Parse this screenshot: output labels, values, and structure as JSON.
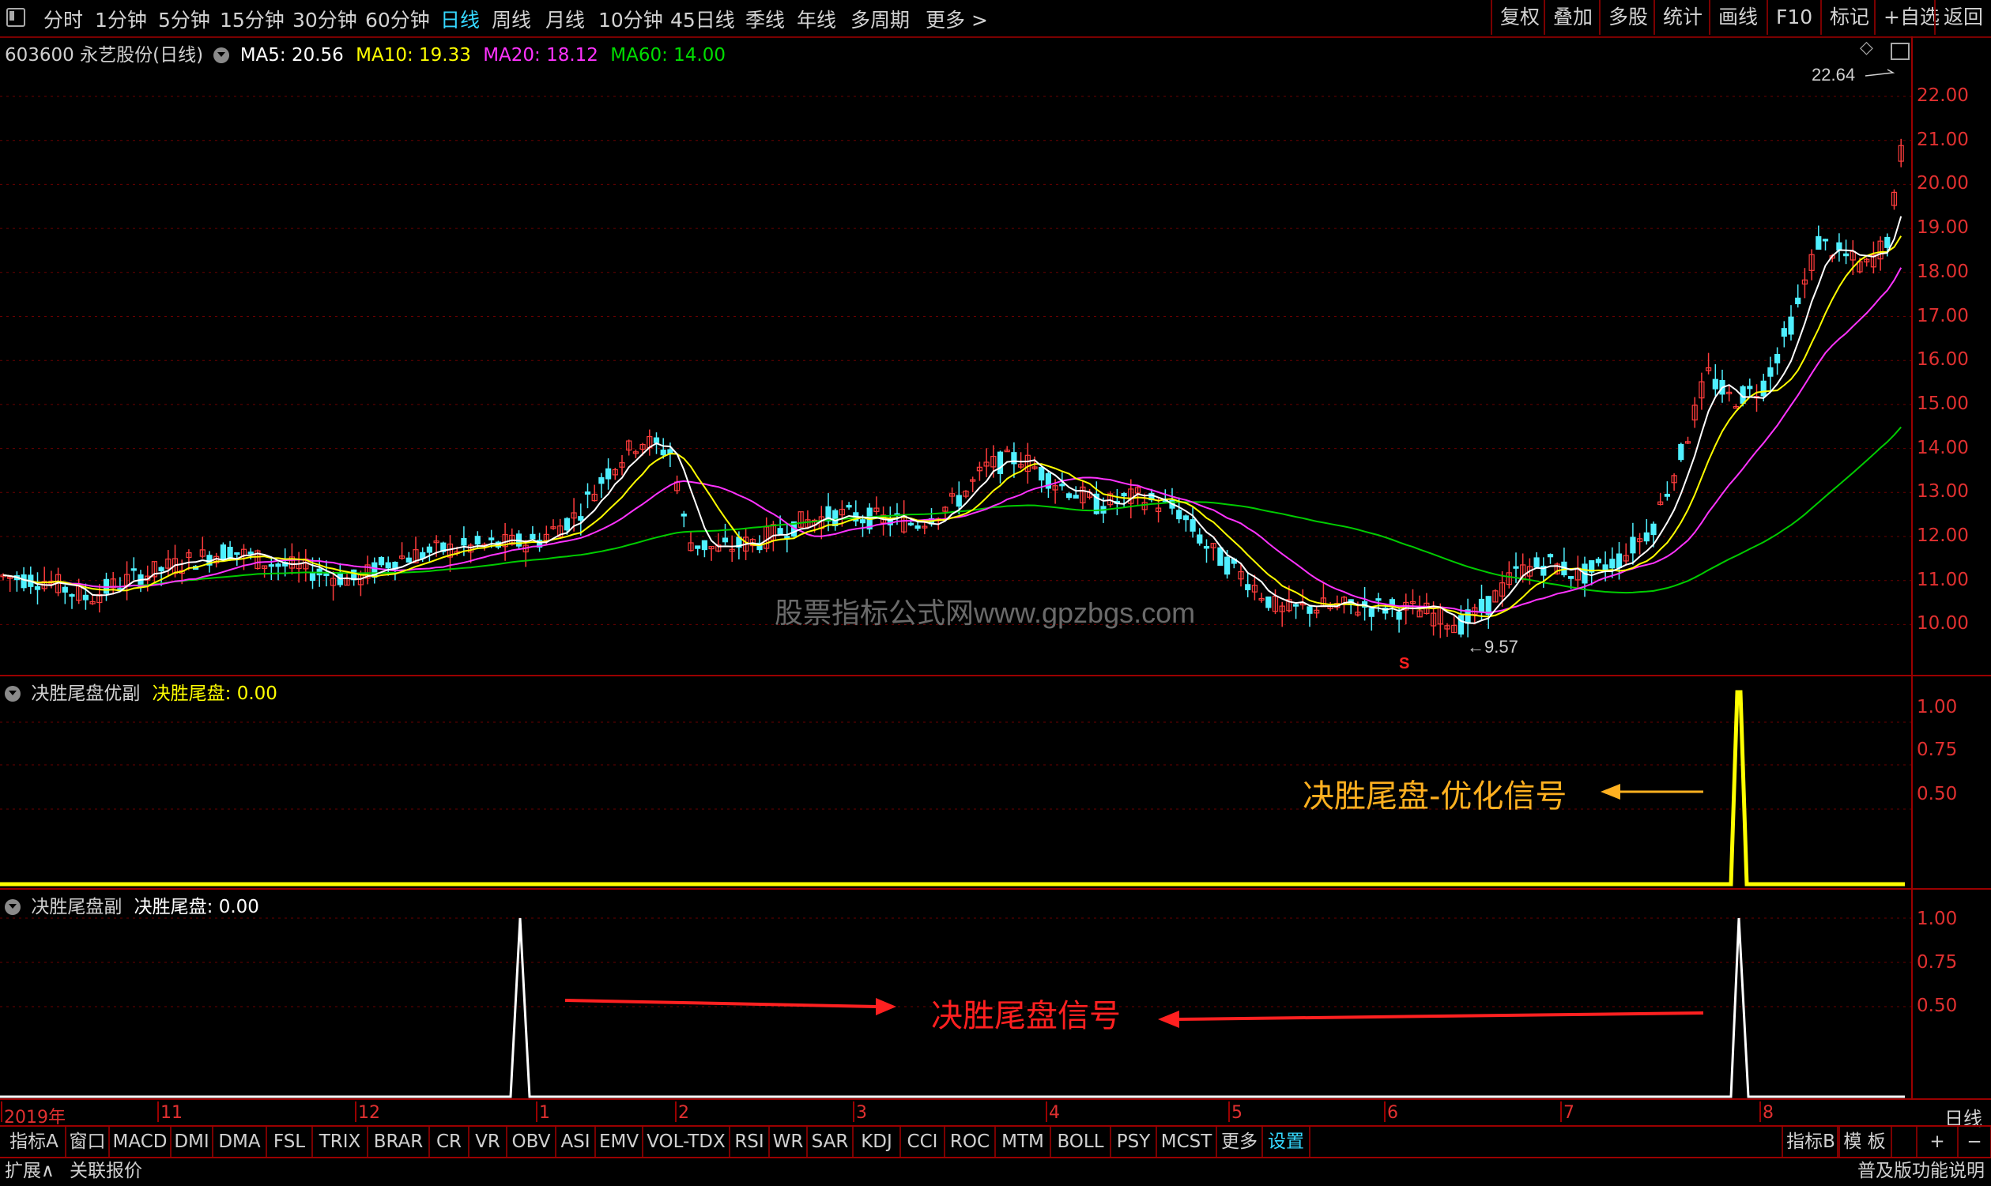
{
  "toolbar": {
    "periods": [
      "分时",
      "1分钟",
      "5分钟",
      "15分钟",
      "30分钟",
      "60分钟",
      "日线",
      "周线",
      "月线",
      "10分钟",
      "45日线",
      "季线",
      "年线",
      "多周期",
      "更多 >"
    ],
    "active_period": "日线",
    "right_buttons": [
      "复权",
      "叠加",
      "多股",
      "统计",
      "画线",
      "F10",
      "标记",
      "+自选",
      "返回"
    ]
  },
  "main_header": {
    "stock": "603600 永艺股份(日线)",
    "ma5": "MA5: 20.56",
    "ma10": "MA10: 19.33",
    "ma20": "MA20: 18.12",
    "ma60": "MA60: 14.00",
    "colors": {
      "ma5": "#ffffff",
      "ma10": "#ffff00",
      "ma20": "#ff33ff",
      "ma60": "#00cc00"
    }
  },
  "main_axis": [
    "22.00",
    "21.00",
    "20.00",
    "19.00",
    "18.00",
    "17.00",
    "16.00",
    "15.00",
    "14.00",
    "13.00",
    "12.00",
    "11.00",
    "10.00"
  ],
  "annotations": {
    "high": "22.64",
    "low": "9.57",
    "watermark": "股票指标公式网www.gpzbgs.com",
    "signal_marker": "S"
  },
  "panel1": {
    "title": "决胜尾盘优副",
    "indicator_label": "决胜尾盘:",
    "indicator_value": "0.00",
    "axis": [
      "1.00",
      "0.75",
      "0.50"
    ],
    "callout": "决胜尾盘-优化信号"
  },
  "panel2": {
    "title": "决胜尾盘副",
    "indicator_label": "决胜尾盘:",
    "indicator_value": "0.00",
    "axis": [
      "1.00",
      "0.75",
      "0.50"
    ],
    "callout": "决胜尾盘信号"
  },
  "x_axis": [
    "2019年",
    "11",
    "12",
    "1",
    "2",
    "3",
    "4",
    "5",
    "6",
    "7",
    "8"
  ],
  "period_label": "日线",
  "bottom_tabs": [
    "指标A",
    "窗口",
    "MACD",
    "DMI",
    "DMA",
    "FSL",
    "TRIX",
    "BRAR",
    "CR",
    "VR",
    "OBV",
    "ASI",
    "EMV",
    "VOL-TDX",
    "RSI",
    "WR",
    "SAR",
    "KDJ",
    "CCI",
    "ROC",
    "MTM",
    "BOLL",
    "PSY",
    "MCST",
    "更多",
    "设置"
  ],
  "bottom_right": [
    "指标B",
    "模 板",
    "+",
    "−"
  ],
  "status": {
    "left1": "扩展∧",
    "left2": "关联报价",
    "right": "普及版功能说明"
  }
}
